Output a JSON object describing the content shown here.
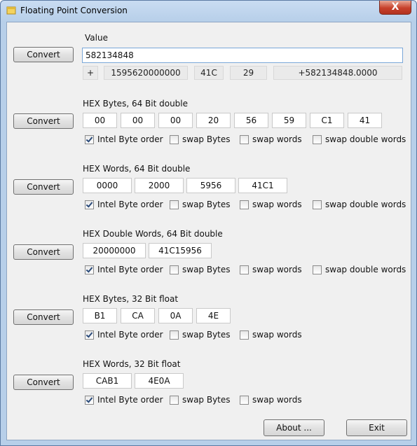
{
  "window": {
    "title": "Floating Point Conversion",
    "close_symbol": "X"
  },
  "value_section": {
    "label": "Value",
    "convert_label": "Convert",
    "input_value": "582134848",
    "sign": "+",
    "mantissa": "1595620000000",
    "exponent_hex": "41C",
    "exponent": "29",
    "formatted": "+582134848.0000"
  },
  "hex_bytes_64": {
    "label": "HEX Bytes, 64 Bit double",
    "convert_label": "Convert",
    "fields": [
      "00",
      "00",
      "00",
      "20",
      "56",
      "59",
      "C1",
      "41"
    ],
    "options": [
      {
        "label": "Intel Byte order",
        "checked": true
      },
      {
        "label": "swap Bytes",
        "checked": false
      },
      {
        "label": "swap words",
        "checked": false
      },
      {
        "label": "swap double words",
        "checked": false
      }
    ]
  },
  "hex_words_64": {
    "label": "HEX Words, 64 Bit double",
    "convert_label": "Convert",
    "fields": [
      "0000",
      "2000",
      "5956",
      "41C1"
    ],
    "options": [
      {
        "label": "Intel Byte order",
        "checked": true
      },
      {
        "label": "swap Bytes",
        "checked": false
      },
      {
        "label": "swap words",
        "checked": false
      },
      {
        "label": "swap double words",
        "checked": false
      }
    ]
  },
  "hex_dwords_64": {
    "label": "HEX Double Words, 64 Bit double",
    "convert_label": "Convert",
    "fields": [
      "20000000",
      "41C15956"
    ],
    "options": [
      {
        "label": "Intel Byte order",
        "checked": true
      },
      {
        "label": "swap Bytes",
        "checked": false
      },
      {
        "label": "swap words",
        "checked": false
      },
      {
        "label": "swap double words",
        "checked": false
      }
    ]
  },
  "hex_bytes_32": {
    "label": "HEX Bytes, 32 Bit float",
    "convert_label": "Convert",
    "fields": [
      "B1",
      "CA",
      "0A",
      "4E"
    ],
    "options": [
      {
        "label": "Intel Byte order",
        "checked": true
      },
      {
        "label": "swap Bytes",
        "checked": false
      },
      {
        "label": "swap words",
        "checked": false
      }
    ]
  },
  "hex_words_32": {
    "label": "HEX Words, 32 Bit float",
    "convert_label": "Convert",
    "fields": [
      "CAB1",
      "4E0A"
    ],
    "options": [
      {
        "label": "Intel Byte order",
        "checked": true
      },
      {
        "label": "swap Bytes",
        "checked": false
      },
      {
        "label": "swap words",
        "checked": false
      }
    ]
  },
  "footer": {
    "about_label": "About ...",
    "exit_label": "Exit"
  }
}
